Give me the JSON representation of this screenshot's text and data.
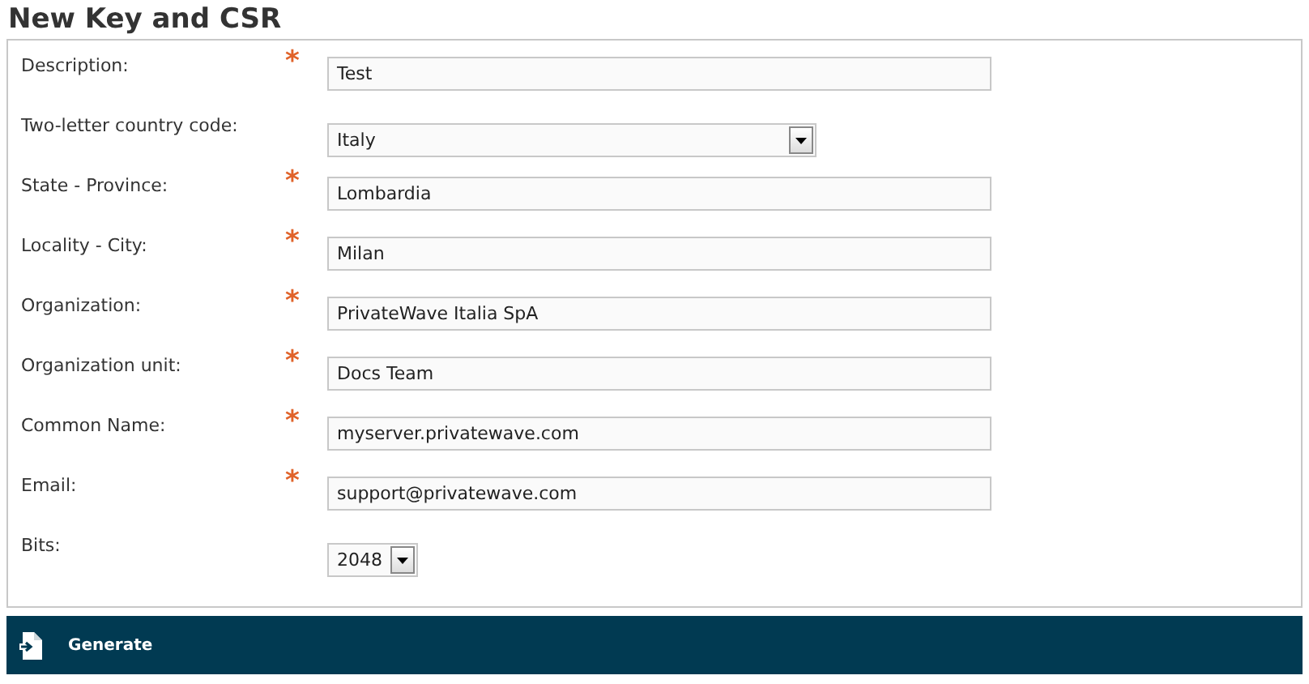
{
  "title": "New Key and CSR",
  "fields": [
    {
      "label": "Description:",
      "kind": "text",
      "required_mark": "*",
      "value": "Test"
    },
    {
      "label": "Two-letter country code:",
      "kind": "select",
      "value": "Italy"
    },
    {
      "label": "State - Province:",
      "kind": "text",
      "required_mark": "*",
      "value": "Lombardia"
    },
    {
      "label": "Locality - City:",
      "kind": "text",
      "required_mark": "*",
      "value": "Milan"
    },
    {
      "label": "Organization:",
      "kind": "text",
      "required_mark": "*",
      "value": "PrivateWave Italia SpA"
    },
    {
      "label": "Organization unit:",
      "kind": "text",
      "required_mark": "*",
      "value": "Docs Team"
    },
    {
      "label": "Common Name:",
      "kind": "text",
      "required_mark": "*",
      "value": "myserver.privatewave.com"
    },
    {
      "label": "Email:",
      "kind": "text",
      "required_mark": "*",
      "value": "support@privatewave.com"
    },
    {
      "label": "Bits:",
      "kind": "small-select",
      "value": "2048"
    }
  ],
  "action": {
    "label": "Generate"
  }
}
